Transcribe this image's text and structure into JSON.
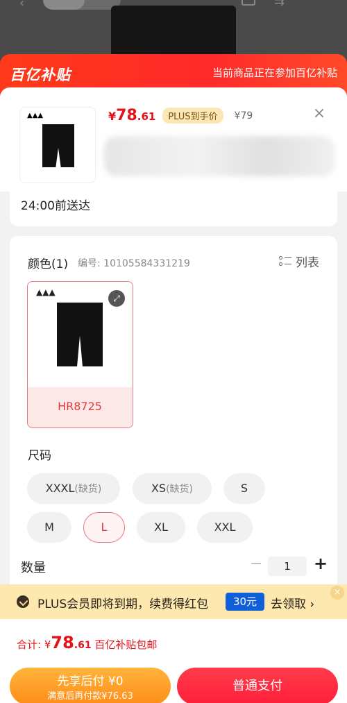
{
  "banner": {
    "logo": "百亿补贴",
    "notice": "当前商品正在参加百亿补贴"
  },
  "product": {
    "price_yen": "¥",
    "price_int": "78",
    "price_dec": ".61",
    "plus_badge": "PLUS到手价",
    "original_price": "¥79",
    "close_symbol": "×",
    "brand_mark": "▲▲▲"
  },
  "delivery": {
    "text": "24:00前送达"
  },
  "color": {
    "title": "颜色(1)",
    "code": "编号: 10105584331219",
    "list_label": "列表",
    "option_label": "HR8725",
    "brand_mark": "▲▲▲"
  },
  "size": {
    "title": "尺码",
    "options": [
      {
        "label": "XXXL",
        "sub": "(缺货)"
      },
      {
        "label": "XS",
        "sub": "(缺货)"
      },
      {
        "label": "S",
        "sub": ""
      },
      {
        "label": "M",
        "sub": ""
      },
      {
        "label": "L",
        "sub": ""
      },
      {
        "label": "XL",
        "sub": ""
      },
      {
        "label": "XXL",
        "sub": ""
      }
    ],
    "selected": "L"
  },
  "quantity": {
    "title": "数量",
    "minus": "−",
    "value": "1",
    "plus": "+"
  },
  "plus_bar": {
    "text": "PLUS会员即将到期，续费得红包",
    "coupon": "30元",
    "claim": "去领取 ›",
    "close": "×"
  },
  "footer": {
    "total_label": "合计: ¥",
    "total_int": "78",
    "total_dec": ".61",
    "total_suffix": " 百亿补贴包邮",
    "bnpl_line1": "先享后付 ¥0",
    "bnpl_line2": "满意后再付款¥76.63",
    "pay_label": "普通支付"
  },
  "colors": {
    "accent_red": "#e4131a",
    "banner_red": "#ff2a2a",
    "plus_gold": "#fde9b0",
    "coupon_blue": "#0f5fd8",
    "bnpl_orange": "#ff9a1f"
  }
}
